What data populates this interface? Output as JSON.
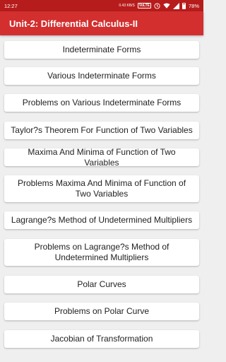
{
  "status_bar": {
    "time": "12:27",
    "net_speed": "0.43 KB/S",
    "volte": "VoLTE",
    "battery": "78%",
    "icons": [
      "clock-icon",
      "wifi-icon",
      "signal-icon",
      "battery-icon"
    ]
  },
  "app_bar": {
    "title": "Unit-2: Differential Calculus-II"
  },
  "topics": [
    {
      "label": "Indeterminate Forms"
    },
    {
      "label": "Various Indeterminate Forms"
    },
    {
      "label": "Problems on Various Indeterminate Forms"
    },
    {
      "label": "Taylor?s Theorem For Function of Two Variables"
    },
    {
      "label": "Maxima And Minima of Function of Two Variables"
    },
    {
      "label": "Problems Maxima And Minima of Function of Two Variables"
    },
    {
      "label": "Lagrange?s Method of Undetermined Multipliers"
    },
    {
      "label": "Problems on Lagrange?s Method of Undetermined Multipliers"
    },
    {
      "label": "Polar Curves"
    },
    {
      "label": "Problems on Polar Curve"
    },
    {
      "label": "Jacobian of Transformation"
    }
  ],
  "colors": {
    "app_bar": "#d32f2f",
    "status_bar": "#b71c1c",
    "background": "#efefef",
    "card": "#ffffff"
  }
}
